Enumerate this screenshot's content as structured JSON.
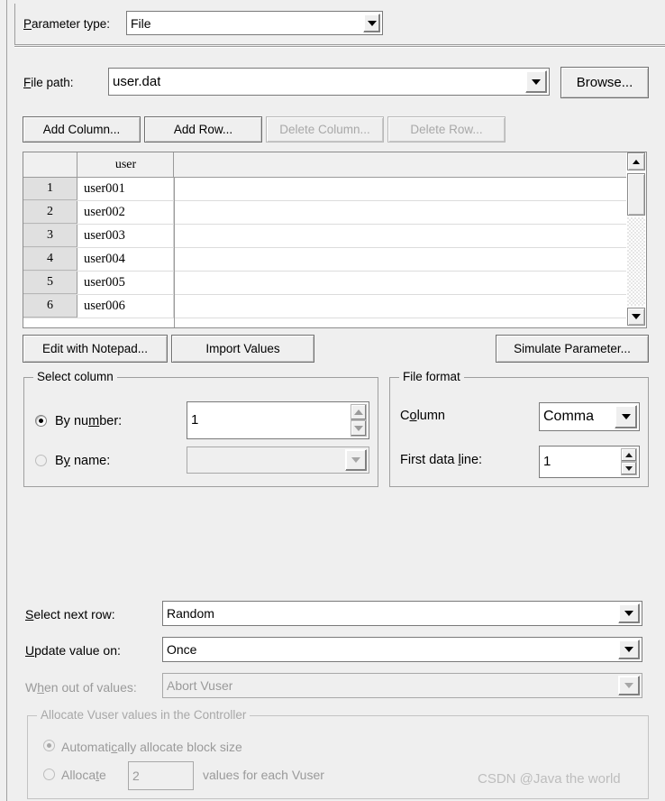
{
  "dialog": {
    "parameter_type": {
      "label": "Parameter type:",
      "label_accel": "P",
      "value": "File",
      "icon": "chevron-down-icon"
    },
    "file_path": {
      "label": "File path:",
      "label_accel": "F",
      "value": "user.dat",
      "browse_label": "Browse...",
      "icon": "chevron-down-icon"
    },
    "table_toolbar": {
      "add_column": {
        "label": "Add Column...",
        "enabled": true
      },
      "add_row": {
        "label": "Add Row...",
        "enabled": true
      },
      "delete_column": {
        "label": "Delete Column...",
        "enabled": false
      },
      "delete_row": {
        "label": "Delete Row...",
        "enabled": false
      }
    },
    "table": {
      "columns": [
        "user"
      ],
      "row_numbers": [
        "1",
        "2",
        "3",
        "4",
        "5",
        "6"
      ],
      "rows": [
        [
          "user001"
        ],
        [
          "user002"
        ],
        [
          "user003"
        ],
        [
          "user004"
        ],
        [
          "user005"
        ],
        [
          "user006"
        ]
      ],
      "scrollbar": {
        "up_icon": "scroll-up-arrow-icon",
        "down_icon": "scroll-down-arrow-icon"
      }
    },
    "bottom_toolbar": {
      "edit_with_notepad": "Edit with Notepad...",
      "import_values": "Import Values",
      "simulate_parameter": "Simulate Parameter..."
    },
    "select_column": {
      "title": "Select column",
      "by_number": {
        "label": "By number:",
        "selected": true,
        "value": "1",
        "up_icon": "spinner-up-icon",
        "down_icon": "spinner-down-icon"
      },
      "by_name": {
        "label": "By name:",
        "selected": false,
        "value": "",
        "enabled": false,
        "icon": "chevron-down-icon"
      }
    },
    "file_format": {
      "title": "File format",
      "column": {
        "label": "Column",
        "value": "Comma",
        "icon": "chevron-down-icon"
      },
      "first_data_line": {
        "label": "First data line:",
        "value": "1",
        "up_icon": "spinner-up-icon",
        "down_icon": "spinner-down-icon"
      }
    },
    "row_options": {
      "select_next_row": {
        "label": "Select next row:",
        "value": "Random",
        "enabled": true,
        "icon": "chevron-down-icon"
      },
      "update_value_on": {
        "label": "Update value on:",
        "value": "Once",
        "enabled": true,
        "icon": "chevron-down-icon"
      },
      "when_out_of_values": {
        "label": "When out of values:",
        "value": "Abort Vuser",
        "enabled": false,
        "icon": "chevron-down-icon"
      }
    },
    "allocate_group": {
      "title": "Allocate Vuser values in the Controller",
      "enabled": false,
      "automatic": {
        "label": "Automatically allocate block size",
        "selected": true
      },
      "manual": {
        "label": "Allocate",
        "selected": false,
        "value": "2",
        "suffix": "values for each Vuser"
      }
    },
    "watermark": "CSDN @Java the world"
  }
}
